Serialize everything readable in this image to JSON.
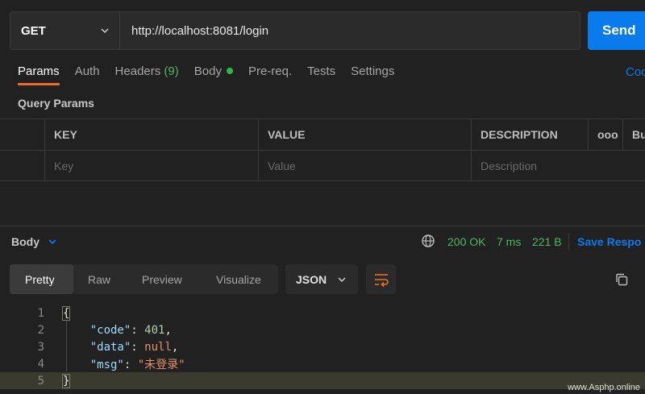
{
  "request": {
    "method": "GET",
    "url": "http://localhost:8081/login",
    "send_label": "Send"
  },
  "tabs": [
    {
      "label": "Params",
      "active": true
    },
    {
      "label": "Auth"
    },
    {
      "label": "Headers",
      "count": "(9)"
    },
    {
      "label": "Body",
      "has_dot": true
    },
    {
      "label": "Pre-req."
    },
    {
      "label": "Tests"
    },
    {
      "label": "Settings"
    }
  ],
  "cookies_label": "Coo",
  "query_params": {
    "title": "Query Params",
    "headers": [
      "KEY",
      "VALUE",
      "DESCRIPTION"
    ],
    "more_icon": "ooo",
    "bulk_edit_label": "Bu",
    "placeholders": [
      "Key",
      "Value",
      "Description"
    ]
  },
  "response": {
    "body_label": "Body",
    "status": "200 OK",
    "time": "7 ms",
    "size": "221 B",
    "save_label": "Save Respo",
    "view_tabs": [
      "Pretty",
      "Raw",
      "Preview",
      "Visualize"
    ],
    "active_view": "Pretty",
    "format": "JSON"
  },
  "code": {
    "line_numbers": [
      "1",
      "2",
      "3",
      "4",
      "5"
    ],
    "open_brace": "{",
    "close_brace": "}",
    "fields": [
      {
        "key": "\"code\"",
        "value": "401",
        "type": "number"
      },
      {
        "key": "\"data\"",
        "value": "null",
        "type": "null"
      },
      {
        "key": "\"msg\"",
        "value": "\"未登录\"",
        "type": "string"
      }
    ]
  },
  "watermark": "www.Asphp.online",
  "colors": {
    "accent": "#097bed",
    "active_tab": "#f06c2a",
    "success": "#4cb85c"
  }
}
